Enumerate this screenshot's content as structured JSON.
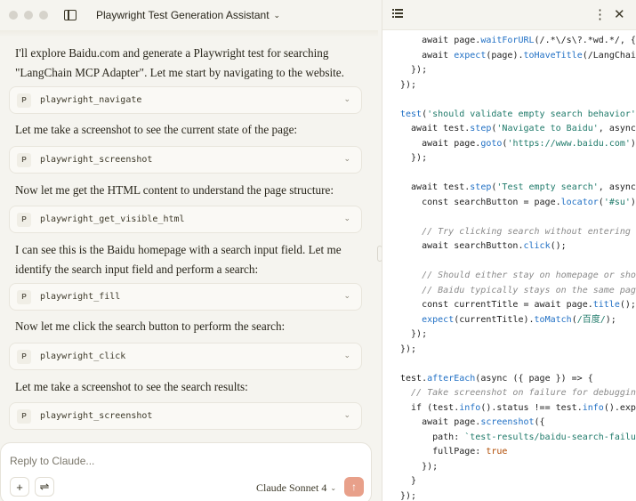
{
  "window": {
    "title": "Playwright Test Generation Assistant"
  },
  "chat": {
    "messages": [
      {
        "text": "I'll explore Baidu.com and generate a Playwright test for searching \"LangChain MCP Adapter\". Let me start by navigating to the website.",
        "tool_badge": "P",
        "tool": "playwright_navigate"
      },
      {
        "text": "Let me take a screenshot to see the current state of the page:",
        "tool_badge": "P",
        "tool": "playwright_screenshot"
      },
      {
        "text": "Now let me get the HTML content to understand the page structure:",
        "tool_badge": "P",
        "tool": "playwright_get_visible_html"
      },
      {
        "text": "I can see this is the Baidu homepage with a search input field. Let me identify the search input field and perform a search:",
        "tool_badge": "P",
        "tool": "playwright_fill"
      },
      {
        "text": "Now let me click the search button to perform the search:",
        "tool_badge": "P",
        "tool": "playwright_click"
      },
      {
        "text": "Let me take a screenshot to see the search results:",
        "tool_badge": "P",
        "tool": "playwright_screenshot"
      }
    ]
  },
  "composer": {
    "placeholder": "Reply to Claude...",
    "add_icon": "+",
    "settings_icon": "⇌",
    "model": "Claude Sonnet 4",
    "send_icon": "↑"
  },
  "artifact_panel": {
    "code_lines": [
      [
        [
          "pl",
          "    await page."
        ],
        [
          "fn",
          "waitForURL"
        ],
        [
          "pl",
          "(/.*\\/s\\?.*wd.*/, { t"
        ]
      ],
      [
        [
          "pl",
          "    await "
        ],
        [
          "fn",
          "expect"
        ],
        [
          "pl",
          "(page)."
        ],
        [
          "fn",
          "toHaveTitle"
        ],
        [
          "pl",
          "(/LangChain"
        ]
      ],
      [
        [
          "pl",
          "  });"
        ]
      ],
      [
        [
          "pl",
          "});"
        ]
      ],
      [
        [
          "pl",
          ""
        ]
      ],
      [
        [
          "fn",
          "test"
        ],
        [
          "pl",
          "("
        ],
        [
          "str",
          "'should validate empty search behavior'"
        ],
        [
          "pl",
          ","
        ]
      ],
      [
        [
          "pl",
          "  await test."
        ],
        [
          "fn",
          "step"
        ],
        [
          "pl",
          "("
        ],
        [
          "str",
          "'Navigate to Baidu'"
        ],
        [
          "pl",
          ", async ("
        ]
      ],
      [
        [
          "pl",
          "    await page."
        ],
        [
          "fn",
          "goto"
        ],
        [
          "pl",
          "("
        ],
        [
          "str",
          "'https://www.baidu.com'"
        ],
        [
          "pl",
          ");"
        ]
      ],
      [
        [
          "pl",
          "  });"
        ]
      ],
      [
        [
          "pl",
          ""
        ]
      ],
      [
        [
          "pl",
          "  await test."
        ],
        [
          "fn",
          "step"
        ],
        [
          "pl",
          "("
        ],
        [
          "str",
          "'Test empty search'"
        ],
        [
          "pl",
          ", async ("
        ]
      ],
      [
        [
          "pl",
          "    const searchButton = page."
        ],
        [
          "fn",
          "locator"
        ],
        [
          "pl",
          "("
        ],
        [
          "str",
          "'#su'"
        ],
        [
          "pl",
          ");"
        ]
      ],
      [
        [
          "pl",
          ""
        ]
      ],
      [
        [
          "cm",
          "    // Try clicking search without entering an"
        ]
      ],
      [
        [
          "pl",
          "    await searchButton."
        ],
        [
          "fn",
          "click"
        ],
        [
          "pl",
          "();"
        ]
      ],
      [
        [
          "pl",
          ""
        ]
      ],
      [
        [
          "cm",
          "    // Should either stay on homepage or show"
        ]
      ],
      [
        [
          "cm",
          "    // Baidu typically stays on the same page"
        ]
      ],
      [
        [
          "pl",
          "    const currentTitle = await page."
        ],
        [
          "fn",
          "title"
        ],
        [
          "pl",
          "();"
        ]
      ],
      [
        [
          "pl",
          "    "
        ],
        [
          "fn",
          "expect"
        ],
        [
          "pl",
          "(currentTitle)."
        ],
        [
          "fn",
          "toMatch"
        ],
        [
          "pl",
          "("
        ],
        [
          "str",
          "/百度/"
        ],
        [
          "pl",
          ");"
        ]
      ],
      [
        [
          "pl",
          "  });"
        ]
      ],
      [
        [
          "pl",
          "});"
        ]
      ],
      [
        [
          "pl",
          ""
        ]
      ],
      [
        [
          "pl",
          "test."
        ],
        [
          "fn",
          "afterEach"
        ],
        [
          "pl",
          "(async ({ page }) => {"
        ]
      ],
      [
        [
          "cm",
          "  // Take screenshot on failure for debugging"
        ]
      ],
      [
        [
          "pl",
          "  if (test."
        ],
        [
          "fn",
          "info"
        ],
        [
          "pl",
          "().status !== test."
        ],
        [
          "fn",
          "info"
        ],
        [
          "pl",
          "().expec"
        ]
      ],
      [
        [
          "pl",
          "    await page."
        ],
        [
          "fn",
          "screenshot"
        ],
        [
          "pl",
          "({"
        ]
      ],
      [
        [
          "pl",
          "      path: "
        ],
        [
          "str",
          "`test-results/baidu-search-failure"
        ]
      ],
      [
        [
          "pl",
          "      fullPage: "
        ],
        [
          "num",
          "true"
        ]
      ],
      [
        [
          "pl",
          "    });"
        ]
      ],
      [
        [
          "pl",
          "  }"
        ]
      ],
      [
        [
          "pl",
          "});"
        ]
      ]
    ]
  }
}
